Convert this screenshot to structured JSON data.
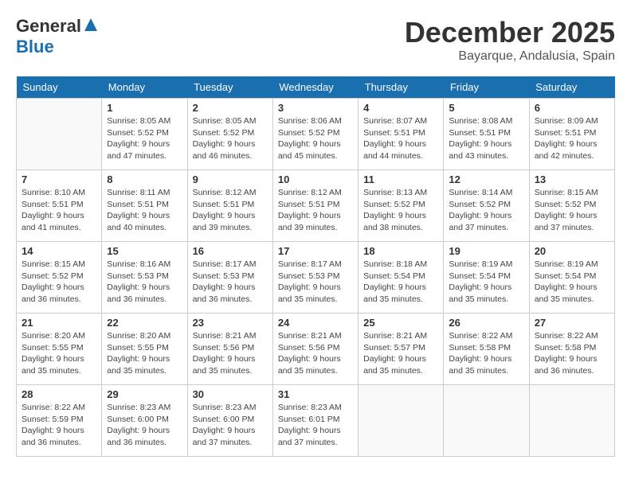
{
  "logo": {
    "general": "General",
    "blue": "Blue"
  },
  "header": {
    "month": "December 2025",
    "location": "Bayarque, Andalusia, Spain"
  },
  "days_of_week": [
    "Sunday",
    "Monday",
    "Tuesday",
    "Wednesday",
    "Thursday",
    "Friday",
    "Saturday"
  ],
  "weeks": [
    [
      {
        "day": "",
        "info": ""
      },
      {
        "day": "1",
        "info": "Sunrise: 8:05 AM\nSunset: 5:52 PM\nDaylight: 9 hours\nand 47 minutes."
      },
      {
        "day": "2",
        "info": "Sunrise: 8:05 AM\nSunset: 5:52 PM\nDaylight: 9 hours\nand 46 minutes."
      },
      {
        "day": "3",
        "info": "Sunrise: 8:06 AM\nSunset: 5:52 PM\nDaylight: 9 hours\nand 45 minutes."
      },
      {
        "day": "4",
        "info": "Sunrise: 8:07 AM\nSunset: 5:51 PM\nDaylight: 9 hours\nand 44 minutes."
      },
      {
        "day": "5",
        "info": "Sunrise: 8:08 AM\nSunset: 5:51 PM\nDaylight: 9 hours\nand 43 minutes."
      },
      {
        "day": "6",
        "info": "Sunrise: 8:09 AM\nSunset: 5:51 PM\nDaylight: 9 hours\nand 42 minutes."
      }
    ],
    [
      {
        "day": "7",
        "info": "Sunrise: 8:10 AM\nSunset: 5:51 PM\nDaylight: 9 hours\nand 41 minutes."
      },
      {
        "day": "8",
        "info": "Sunrise: 8:11 AM\nSunset: 5:51 PM\nDaylight: 9 hours\nand 40 minutes."
      },
      {
        "day": "9",
        "info": "Sunrise: 8:12 AM\nSunset: 5:51 PM\nDaylight: 9 hours\nand 39 minutes."
      },
      {
        "day": "10",
        "info": "Sunrise: 8:12 AM\nSunset: 5:51 PM\nDaylight: 9 hours\nand 39 minutes."
      },
      {
        "day": "11",
        "info": "Sunrise: 8:13 AM\nSunset: 5:52 PM\nDaylight: 9 hours\nand 38 minutes."
      },
      {
        "day": "12",
        "info": "Sunrise: 8:14 AM\nSunset: 5:52 PM\nDaylight: 9 hours\nand 37 minutes."
      },
      {
        "day": "13",
        "info": "Sunrise: 8:15 AM\nSunset: 5:52 PM\nDaylight: 9 hours\nand 37 minutes."
      }
    ],
    [
      {
        "day": "14",
        "info": "Sunrise: 8:15 AM\nSunset: 5:52 PM\nDaylight: 9 hours\nand 36 minutes."
      },
      {
        "day": "15",
        "info": "Sunrise: 8:16 AM\nSunset: 5:53 PM\nDaylight: 9 hours\nand 36 minutes."
      },
      {
        "day": "16",
        "info": "Sunrise: 8:17 AM\nSunset: 5:53 PM\nDaylight: 9 hours\nand 36 minutes."
      },
      {
        "day": "17",
        "info": "Sunrise: 8:17 AM\nSunset: 5:53 PM\nDaylight: 9 hours\nand 35 minutes."
      },
      {
        "day": "18",
        "info": "Sunrise: 8:18 AM\nSunset: 5:54 PM\nDaylight: 9 hours\nand 35 minutes."
      },
      {
        "day": "19",
        "info": "Sunrise: 8:19 AM\nSunset: 5:54 PM\nDaylight: 9 hours\nand 35 minutes."
      },
      {
        "day": "20",
        "info": "Sunrise: 8:19 AM\nSunset: 5:54 PM\nDaylight: 9 hours\nand 35 minutes."
      }
    ],
    [
      {
        "day": "21",
        "info": "Sunrise: 8:20 AM\nSunset: 5:55 PM\nDaylight: 9 hours\nand 35 minutes."
      },
      {
        "day": "22",
        "info": "Sunrise: 8:20 AM\nSunset: 5:55 PM\nDaylight: 9 hours\nand 35 minutes."
      },
      {
        "day": "23",
        "info": "Sunrise: 8:21 AM\nSunset: 5:56 PM\nDaylight: 9 hours\nand 35 minutes."
      },
      {
        "day": "24",
        "info": "Sunrise: 8:21 AM\nSunset: 5:56 PM\nDaylight: 9 hours\nand 35 minutes."
      },
      {
        "day": "25",
        "info": "Sunrise: 8:21 AM\nSunset: 5:57 PM\nDaylight: 9 hours\nand 35 minutes."
      },
      {
        "day": "26",
        "info": "Sunrise: 8:22 AM\nSunset: 5:58 PM\nDaylight: 9 hours\nand 35 minutes."
      },
      {
        "day": "27",
        "info": "Sunrise: 8:22 AM\nSunset: 5:58 PM\nDaylight: 9 hours\nand 36 minutes."
      }
    ],
    [
      {
        "day": "28",
        "info": "Sunrise: 8:22 AM\nSunset: 5:59 PM\nDaylight: 9 hours\nand 36 minutes."
      },
      {
        "day": "29",
        "info": "Sunrise: 8:23 AM\nSunset: 6:00 PM\nDaylight: 9 hours\nand 36 minutes."
      },
      {
        "day": "30",
        "info": "Sunrise: 8:23 AM\nSunset: 6:00 PM\nDaylight: 9 hours\nand 37 minutes."
      },
      {
        "day": "31",
        "info": "Sunrise: 8:23 AM\nSunset: 6:01 PM\nDaylight: 9 hours\nand 37 minutes."
      },
      {
        "day": "",
        "info": ""
      },
      {
        "day": "",
        "info": ""
      },
      {
        "day": "",
        "info": ""
      }
    ]
  ]
}
